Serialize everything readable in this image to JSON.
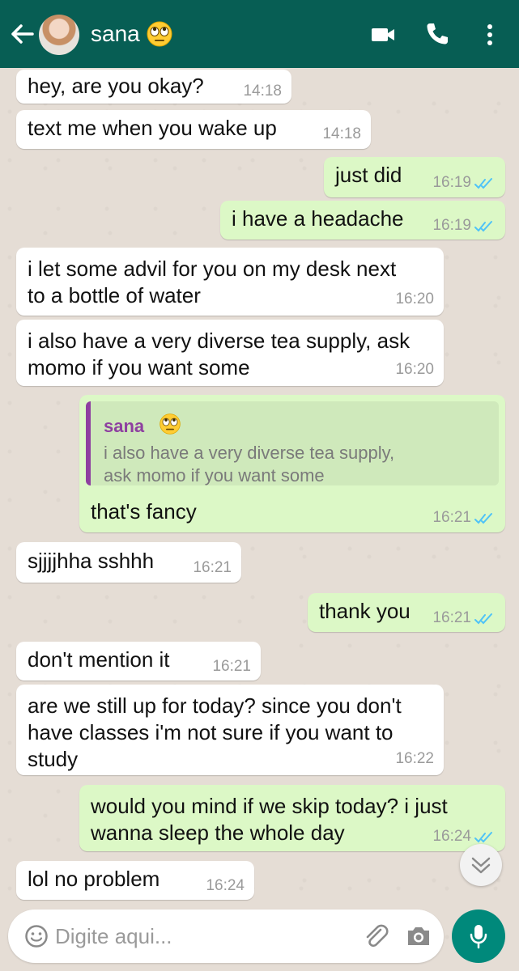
{
  "header": {
    "contact_name": "sana",
    "emoji": "face-with-rolling-eyes",
    "icons": [
      "back-arrow-icon",
      "video-call-icon",
      "phone-icon",
      "more-options-icon"
    ]
  },
  "messages": [
    {
      "id": "m1",
      "direction": "incoming",
      "text": "hey, are you okay?",
      "time": "14:18"
    },
    {
      "id": "m2",
      "direction": "incoming",
      "text": "text me when you wake up",
      "time": "14:18"
    },
    {
      "id": "m3",
      "direction": "outgoing",
      "text": "just did",
      "time": "16:19",
      "status": "read"
    },
    {
      "id": "m4",
      "direction": "outgoing",
      "text": "i have a headache",
      "time": "16:19",
      "status": "read"
    },
    {
      "id": "m5",
      "direction": "incoming",
      "text": "i let some advil for you on my desk next\nto a bottle of water",
      "time": "16:20"
    },
    {
      "id": "m6",
      "direction": "incoming",
      "text": "i also have a very diverse tea supply, ask\nmomo if you want some",
      "time": "16:20"
    },
    {
      "id": "m7",
      "direction": "outgoing",
      "text": "that's fancy",
      "time": "16:21",
      "status": "read",
      "quote": {
        "author": "sana",
        "text": "i also have a very diverse tea supply,\nask momo if you want some"
      }
    },
    {
      "id": "m8",
      "direction": "incoming",
      "text": "sjjjjhha sshhh",
      "time": "16:21"
    },
    {
      "id": "m9",
      "direction": "outgoing",
      "text": "thank you",
      "time": "16:21",
      "status": "read"
    },
    {
      "id": "m10",
      "direction": "incoming",
      "text": "don't mention it",
      "time": "16:21"
    },
    {
      "id": "m11",
      "direction": "incoming",
      "text": "are we still up for today? since you don't\nhave classes i'm not sure if you want to\nstudy",
      "time": "16:22"
    },
    {
      "id": "m12",
      "direction": "outgoing",
      "text": "would you mind if we skip today? i just\nwanna sleep the whole day",
      "time": "16:24",
      "status": "read"
    },
    {
      "id": "m13",
      "direction": "incoming",
      "text": "lol no problem",
      "time": "16:24"
    }
  ],
  "composer": {
    "placeholder": "Digite aqui...",
    "icons": [
      "emoji-icon",
      "attach-icon",
      "camera-icon",
      "mic-icon"
    ]
  },
  "colors": {
    "header": "#075e54",
    "incoming_bubble": "#ffffff",
    "outgoing_bubble": "#dcf8c6",
    "read_ticks": "#4fc3f7",
    "quote_accent": "#8e3fa0",
    "mic_button": "#00897b"
  }
}
